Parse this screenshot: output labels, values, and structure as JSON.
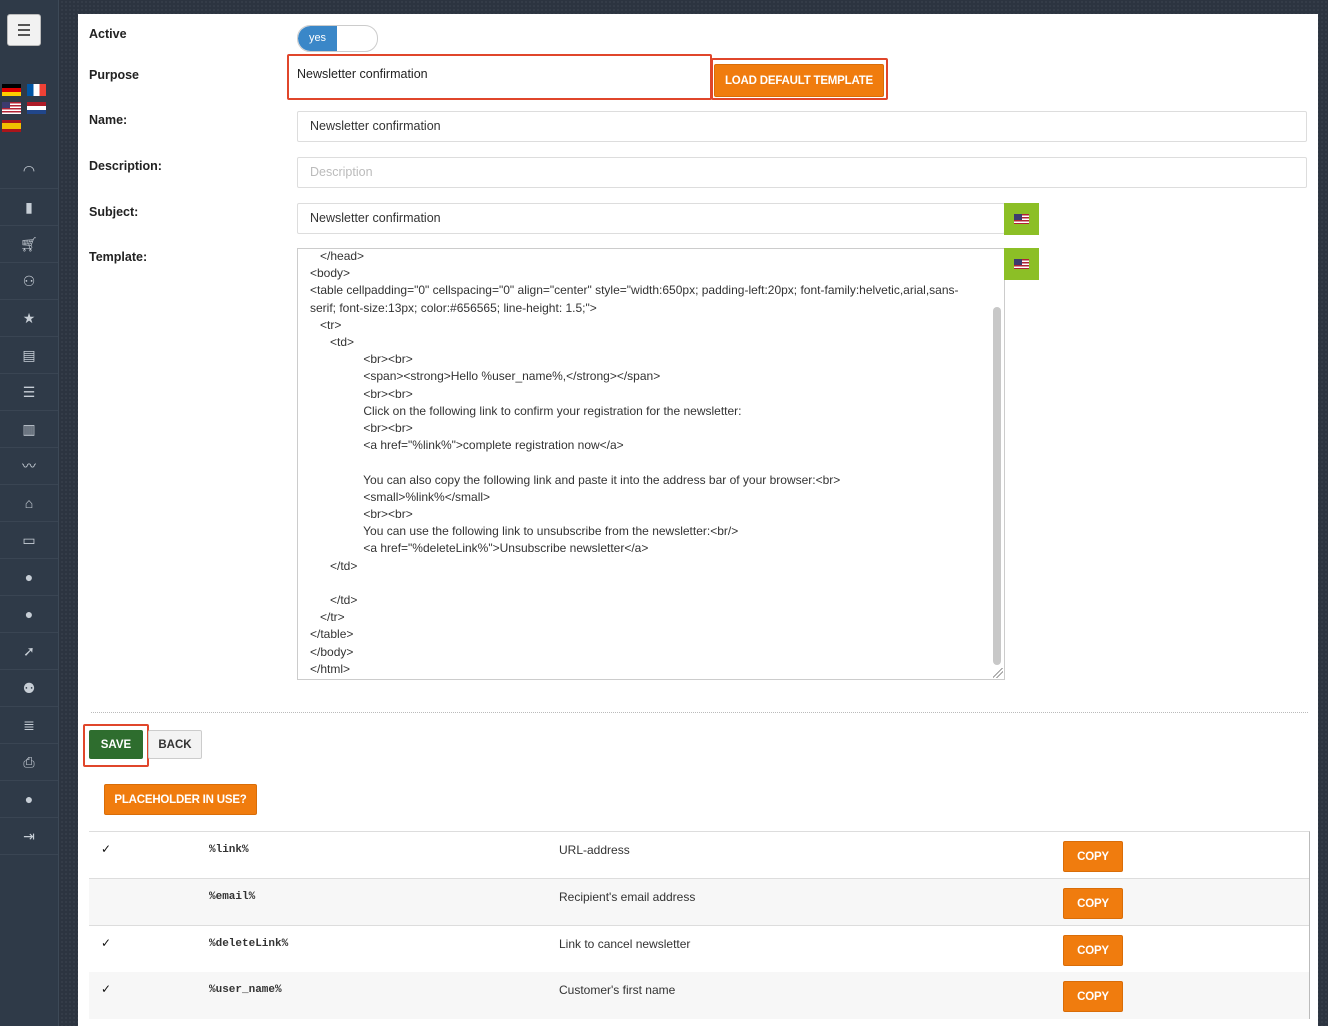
{
  "sidebar": {
    "menu_icon": "hamburger-icon",
    "flags": [
      "de",
      "fr",
      "us",
      "nl",
      "es"
    ],
    "nav_icons": [
      "dashboard-icon",
      "bar-chart-icon",
      "cart-icon",
      "add-user-icon",
      "star-icon",
      "archive-icon",
      "list-icon",
      "book-icon",
      "line-chart-icon",
      "home-icon",
      "monitor-icon",
      "user-icon",
      "user-icon",
      "rocket-icon",
      "users-icon",
      "database-icon",
      "print-icon",
      "user-icon",
      "logout-icon"
    ]
  },
  "form": {
    "active_label": "Active",
    "active_value": "yes",
    "purpose_label": "Purpose",
    "purpose_value": "Newsletter confirmation",
    "load_default_label": "LOAD DEFAULT TEMPLATE",
    "name_label": "Name:",
    "name_value": "Newsletter confirmation",
    "description_label": "Description:",
    "description_placeholder": "Description",
    "subject_label": "Subject:",
    "subject_value": "Newsletter confirmation",
    "template_label": "Template:",
    "template_lines": [
      "   </head>",
      "<body>",
      "<table cellpadding=\"0\" cellspacing=\"0\" align=\"center\" style=\"width:650px; padding-left:20px; font-family:helvetic,arial,sans-",
      "serif; font-size:13px; color:#656565; line-height: 1.5;\">",
      "   <tr>",
      "      <td>",
      "                <br><br>",
      "                <span><strong>Hello %user_name%,</strong></span>",
      "                <br><br>",
      "                Click on the following link to confirm your registration for the newsletter:",
      "                <br><br>",
      "                <a href=\"%link%\">complete registration now</a>",
      "",
      "                You can also copy the following link and paste it into the address bar of your browser:<br>",
      "                <small>%link%</small>",
      "                <br><br>",
      "                You can use the following link to unsubscribe from the newsletter:<br/>",
      "                <a href=\"%deleteLink%\">Unsubscribe newsletter</a>",
      "      </td>",
      "",
      "      </td>",
      "   </tr>",
      "</table>",
      "</body>",
      "</html>"
    ]
  },
  "actions": {
    "save_label": "SAVE",
    "back_label": "BACK",
    "placeholder_label": "PLACEHOLDER IN USE?"
  },
  "placeholders": [
    {
      "check": "✓",
      "name": "%link%",
      "desc": "URL-address",
      "copy": "COPY"
    },
    {
      "check": "",
      "name": "%email%",
      "desc": "Recipient's email address",
      "copy": "COPY"
    },
    {
      "check": "✓",
      "name": "%deleteLink%",
      "desc": "Link to cancel newsletter",
      "copy": "COPY"
    },
    {
      "check": "✓",
      "name": "%user_name%",
      "desc": "Customer's first name",
      "copy": "COPY"
    }
  ],
  "colors": {
    "accent_orange": "#f07c0e",
    "save_green": "#2e6d2e",
    "toggle_blue": "#3a87c8",
    "flag_button_green": "#8cbf26",
    "highlight_red": "#e0462b"
  }
}
